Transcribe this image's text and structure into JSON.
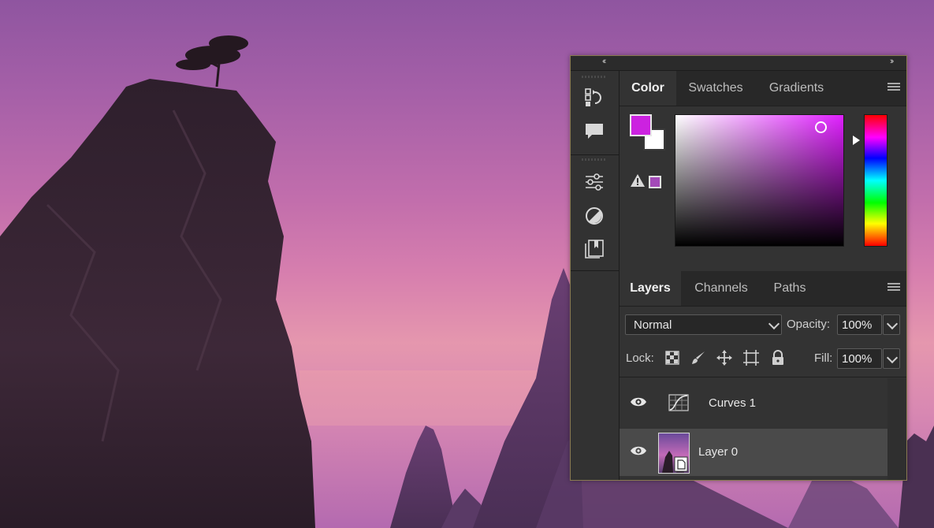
{
  "panel": {
    "collapse_icon": "double-chevron-left",
    "expand_icon": "double-chevron-right",
    "tools": [
      "history-icon",
      "comment-icon",
      "adjustments-icon",
      "styles-icon",
      "libraries-icon"
    ]
  },
  "color_panel": {
    "tabs": [
      {
        "label": "Color",
        "active": true
      },
      {
        "label": "Swatches",
        "active": false
      },
      {
        "label": "Gradients",
        "active": false
      }
    ],
    "foreground_color": "#cc22e0",
    "background_color": "#ffffff",
    "gamut_warning_color": "#a34ab8",
    "picker_hue_color": "#e020ff"
  },
  "layers_panel": {
    "tabs": [
      {
        "label": "Layers",
        "active": true
      },
      {
        "label": "Channels",
        "active": false
      },
      {
        "label": "Paths",
        "active": false
      }
    ],
    "blend_mode": "Normal",
    "opacity_label": "Opacity:",
    "opacity_value": "100%",
    "lock_label": "Lock:",
    "fill_label": "Fill:",
    "fill_value": "100%",
    "layers": [
      {
        "name": "Curves 1",
        "visible": true,
        "type": "adjustment-curves",
        "selected": false
      },
      {
        "name": "Layer 0",
        "visible": true,
        "type": "image",
        "selected": true
      }
    ]
  }
}
